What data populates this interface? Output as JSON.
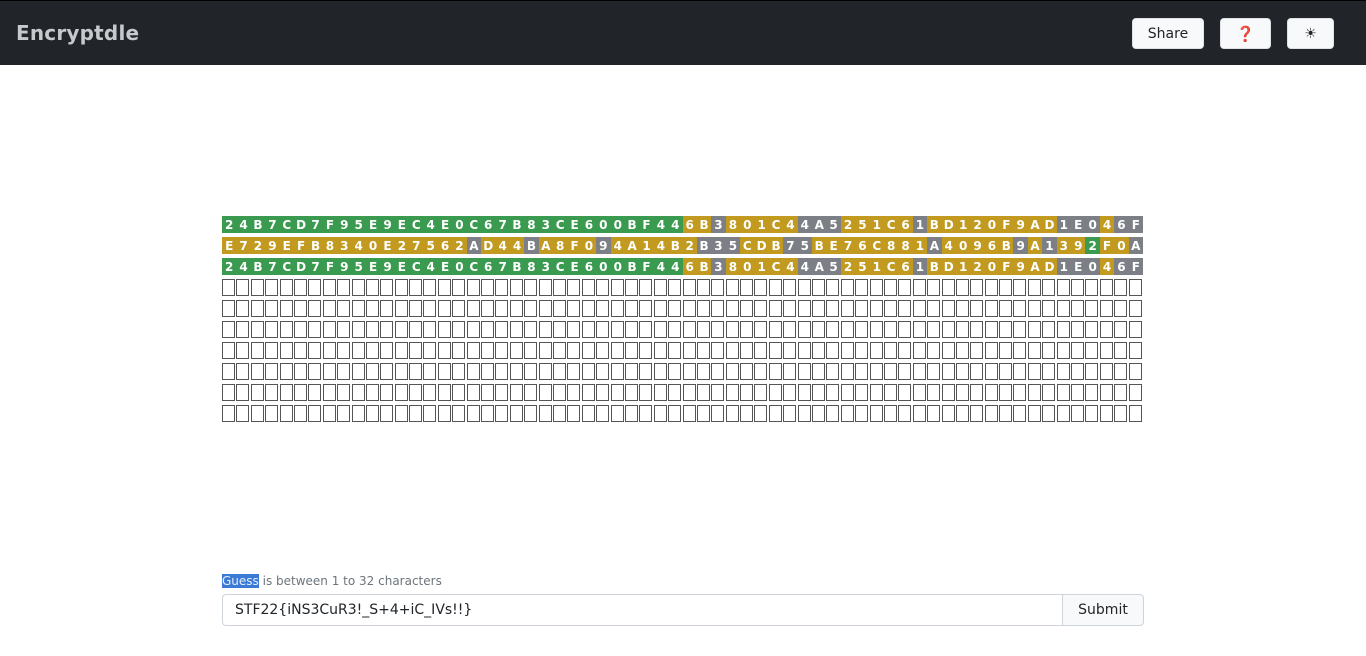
{
  "app": {
    "title": "Encryptdle"
  },
  "nav": {
    "share_label": "Share",
    "help_label": "❓",
    "theme_label": "☀"
  },
  "board": {
    "columns": 64,
    "rows": [
      {
        "text": "24B7CD7F95E9EC4E0C67B83CE600BF446B3801C44A5251C61BD120F9AD1E046F",
        "states": "ggggggggggggggggggggggggggggggggyyxyyyyyxxxyyyyyxyyyyyyyyyxxxyxxxy"
      },
      {
        "text": "E729EFB8340E27562AD44BA8F094A14B2B35CDB75BE76C881A4096B9A1392F0A",
        "states": "yyyyyyyyyyyyyyyyyxyyyxyyyyxyyyyyyxxxyyyxxyyyyyyyyxyyyyyxyxyygyyx"
      },
      {
        "text": "24B7CD7F95E9EC4E0C67B83CE600BF446B3801C44A5251C61BD120F9AD1E046F",
        "states": "ggggggggggggggggggggggggggggggggyyxyyyyyxxxyyyyyxyyyyyyyyyxxxyxxxy"
      },
      {
        "text": "",
        "states": ""
      },
      {
        "text": "",
        "states": ""
      },
      {
        "text": "",
        "states": ""
      },
      {
        "text": "",
        "states": ""
      },
      {
        "text": "",
        "states": ""
      },
      {
        "text": "",
        "states": ""
      },
      {
        "text": "",
        "states": ""
      }
    ]
  },
  "guess": {
    "hint_highlight": "Guess",
    "hint_rest": " is between 1 to 32 characters",
    "value": "STF22{iNS3CuR3!_S+4+iC_IVs!!}",
    "submit_label": "Submit"
  }
}
